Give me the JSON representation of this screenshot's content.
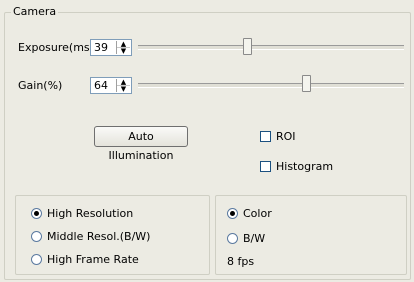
{
  "camera": {
    "group_title": "Camera",
    "exposure": {
      "label": "Exposure(ms)",
      "value": "39",
      "slider_fraction": 0.41
    },
    "gain": {
      "label": "Gain(%)",
      "value": "64",
      "slider_fraction": 0.64
    },
    "auto_illumination_label": "Auto Illumination",
    "roi": {
      "label": "ROI",
      "checked": false
    },
    "histogram": {
      "label": "Histogram",
      "checked": false
    },
    "resolution_options": [
      {
        "label": "High Resolution",
        "selected": true
      },
      {
        "label": "Middle Resol.(B/W)",
        "selected": false
      },
      {
        "label": "High Frame Rate",
        "selected": false
      }
    ],
    "color_options": [
      {
        "label": "Color",
        "selected": true
      },
      {
        "label": "B/W",
        "selected": false
      }
    ],
    "fps": "8 fps"
  }
}
